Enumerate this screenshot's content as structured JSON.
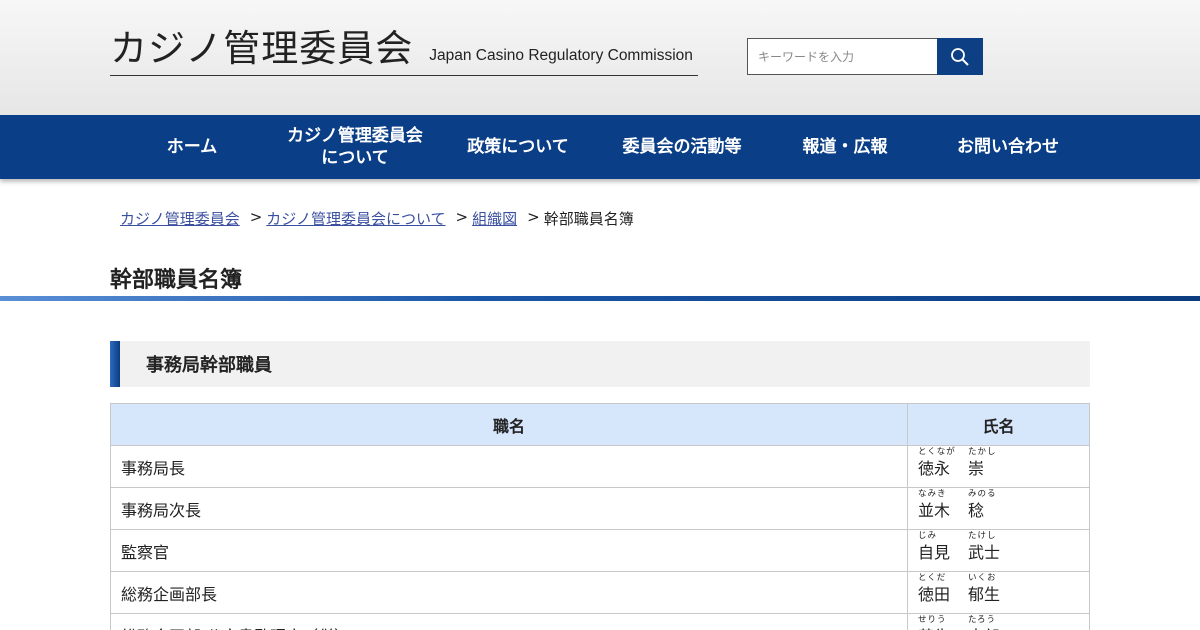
{
  "header": {
    "logo_jp": "カジノ管理委員会",
    "logo_en": "Japan Casino Regulatory Commission",
    "search_placeholder": "キーワードを入力"
  },
  "nav": {
    "items": [
      {
        "label": "ホーム"
      },
      {
        "label": "カジノ管理委員会\nについて"
      },
      {
        "label": "政策について"
      },
      {
        "label": "委員会の活動等"
      },
      {
        "label": "報道・広報"
      },
      {
        "label": "お問い合わせ"
      }
    ]
  },
  "breadcrumb": {
    "items": [
      "カジノ管理委員会",
      "カジノ管理委員会について",
      "組織図"
    ],
    "current": "幹部職員名簿",
    "separator": ">"
  },
  "page": {
    "title": "幹部職員名簿",
    "section_heading": "事務局幹部職員"
  },
  "table": {
    "headers": {
      "position": "職名",
      "name": "氏名"
    },
    "rows": [
      {
        "position": "事務局長",
        "surname": "徳永",
        "surname_ruby": "とくなが",
        "given": "崇",
        "given_ruby": "たかし"
      },
      {
        "position": "事務局次長",
        "surname": "並木",
        "surname_ruby": "なみき",
        "given": "稔",
        "given_ruby": "みのる"
      },
      {
        "position": "監察官",
        "surname": "自見",
        "surname_ruby": "じみ",
        "given": "武士",
        "given_ruby": "たけし"
      },
      {
        "position": "総務企画部長",
        "surname": "徳田",
        "surname_ruby": "とくだ",
        "given": "郁生",
        "given_ruby": "いくお"
      },
      {
        "position": "総務企画部 公文書監理官（併）",
        "surname": "芹生",
        "surname_ruby": "せりう",
        "given": "太郎",
        "given_ruby": "たろう"
      }
    ]
  },
  "colors": {
    "nav_bg": "#0a3e86",
    "search_button": "#0d3f85",
    "link": "#3a4fa0",
    "table_header_bg": "#d6e6fb",
    "section_bg": "#f1f1f1"
  },
  "icons": {
    "search": "search-icon"
  }
}
